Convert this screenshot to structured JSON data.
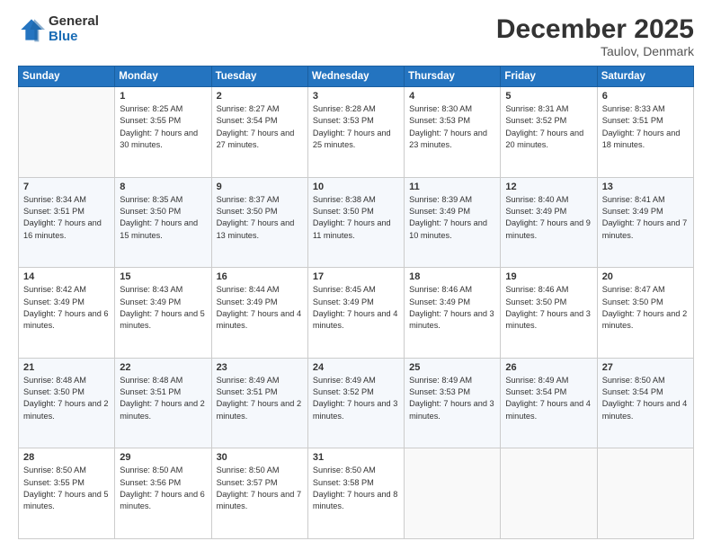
{
  "header": {
    "logo_general": "General",
    "logo_blue": "Blue",
    "month_title": "December 2025",
    "location": "Taulov, Denmark"
  },
  "days_of_week": [
    "Sunday",
    "Monday",
    "Tuesday",
    "Wednesday",
    "Thursday",
    "Friday",
    "Saturday"
  ],
  "weeks": [
    [
      {
        "day": "",
        "info": ""
      },
      {
        "day": "1",
        "info": "Sunrise: 8:25 AM\nSunset: 3:55 PM\nDaylight: 7 hours\nand 30 minutes."
      },
      {
        "day": "2",
        "info": "Sunrise: 8:27 AM\nSunset: 3:54 PM\nDaylight: 7 hours\nand 27 minutes."
      },
      {
        "day": "3",
        "info": "Sunrise: 8:28 AM\nSunset: 3:53 PM\nDaylight: 7 hours\nand 25 minutes."
      },
      {
        "day": "4",
        "info": "Sunrise: 8:30 AM\nSunset: 3:53 PM\nDaylight: 7 hours\nand 23 minutes."
      },
      {
        "day": "5",
        "info": "Sunrise: 8:31 AM\nSunset: 3:52 PM\nDaylight: 7 hours\nand 20 minutes."
      },
      {
        "day": "6",
        "info": "Sunrise: 8:33 AM\nSunset: 3:51 PM\nDaylight: 7 hours\nand 18 minutes."
      }
    ],
    [
      {
        "day": "7",
        "info": "Sunrise: 8:34 AM\nSunset: 3:51 PM\nDaylight: 7 hours\nand 16 minutes."
      },
      {
        "day": "8",
        "info": "Sunrise: 8:35 AM\nSunset: 3:50 PM\nDaylight: 7 hours\nand 15 minutes."
      },
      {
        "day": "9",
        "info": "Sunrise: 8:37 AM\nSunset: 3:50 PM\nDaylight: 7 hours\nand 13 minutes."
      },
      {
        "day": "10",
        "info": "Sunrise: 8:38 AM\nSunset: 3:50 PM\nDaylight: 7 hours\nand 11 minutes."
      },
      {
        "day": "11",
        "info": "Sunrise: 8:39 AM\nSunset: 3:49 PM\nDaylight: 7 hours\nand 10 minutes."
      },
      {
        "day": "12",
        "info": "Sunrise: 8:40 AM\nSunset: 3:49 PM\nDaylight: 7 hours\nand 9 minutes."
      },
      {
        "day": "13",
        "info": "Sunrise: 8:41 AM\nSunset: 3:49 PM\nDaylight: 7 hours\nand 7 minutes."
      }
    ],
    [
      {
        "day": "14",
        "info": "Sunrise: 8:42 AM\nSunset: 3:49 PM\nDaylight: 7 hours\nand 6 minutes."
      },
      {
        "day": "15",
        "info": "Sunrise: 8:43 AM\nSunset: 3:49 PM\nDaylight: 7 hours\nand 5 minutes."
      },
      {
        "day": "16",
        "info": "Sunrise: 8:44 AM\nSunset: 3:49 PM\nDaylight: 7 hours\nand 4 minutes."
      },
      {
        "day": "17",
        "info": "Sunrise: 8:45 AM\nSunset: 3:49 PM\nDaylight: 7 hours\nand 4 minutes."
      },
      {
        "day": "18",
        "info": "Sunrise: 8:46 AM\nSunset: 3:49 PM\nDaylight: 7 hours\nand 3 minutes."
      },
      {
        "day": "19",
        "info": "Sunrise: 8:46 AM\nSunset: 3:50 PM\nDaylight: 7 hours\nand 3 minutes."
      },
      {
        "day": "20",
        "info": "Sunrise: 8:47 AM\nSunset: 3:50 PM\nDaylight: 7 hours\nand 2 minutes."
      }
    ],
    [
      {
        "day": "21",
        "info": "Sunrise: 8:48 AM\nSunset: 3:50 PM\nDaylight: 7 hours\nand 2 minutes."
      },
      {
        "day": "22",
        "info": "Sunrise: 8:48 AM\nSunset: 3:51 PM\nDaylight: 7 hours\nand 2 minutes."
      },
      {
        "day": "23",
        "info": "Sunrise: 8:49 AM\nSunset: 3:51 PM\nDaylight: 7 hours\nand 2 minutes."
      },
      {
        "day": "24",
        "info": "Sunrise: 8:49 AM\nSunset: 3:52 PM\nDaylight: 7 hours\nand 3 minutes."
      },
      {
        "day": "25",
        "info": "Sunrise: 8:49 AM\nSunset: 3:53 PM\nDaylight: 7 hours\nand 3 minutes."
      },
      {
        "day": "26",
        "info": "Sunrise: 8:49 AM\nSunset: 3:54 PM\nDaylight: 7 hours\nand 4 minutes."
      },
      {
        "day": "27",
        "info": "Sunrise: 8:50 AM\nSunset: 3:54 PM\nDaylight: 7 hours\nand 4 minutes."
      }
    ],
    [
      {
        "day": "28",
        "info": "Sunrise: 8:50 AM\nSunset: 3:55 PM\nDaylight: 7 hours\nand 5 minutes."
      },
      {
        "day": "29",
        "info": "Sunrise: 8:50 AM\nSunset: 3:56 PM\nDaylight: 7 hours\nand 6 minutes."
      },
      {
        "day": "30",
        "info": "Sunrise: 8:50 AM\nSunset: 3:57 PM\nDaylight: 7 hours\nand 7 minutes."
      },
      {
        "day": "31",
        "info": "Sunrise: 8:50 AM\nSunset: 3:58 PM\nDaylight: 7 hours\nand 8 minutes."
      },
      {
        "day": "",
        "info": ""
      },
      {
        "day": "",
        "info": ""
      },
      {
        "day": "",
        "info": ""
      }
    ]
  ]
}
